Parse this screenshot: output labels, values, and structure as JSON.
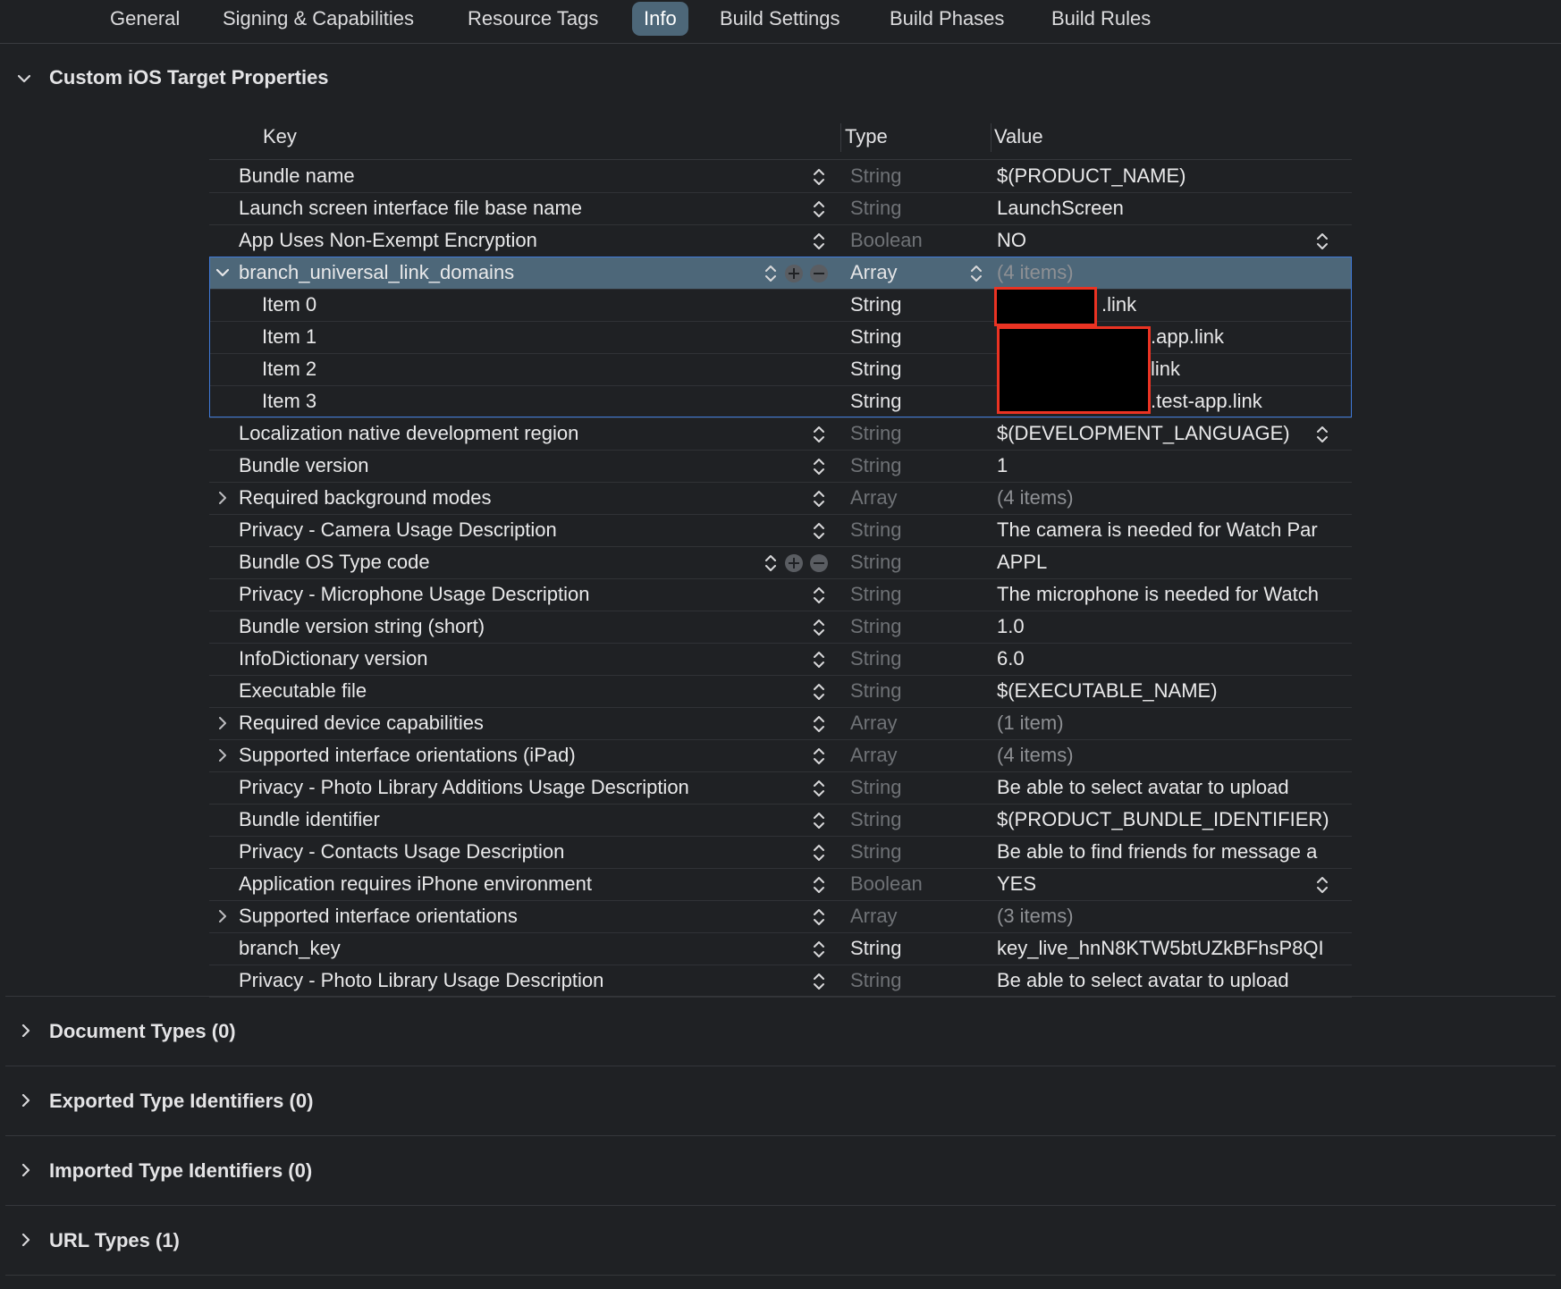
{
  "tabs": [
    {
      "label": "General"
    },
    {
      "label": "Signing & Capabilities"
    },
    {
      "label": "Resource Tags"
    },
    {
      "label": "Info",
      "active": true
    },
    {
      "label": "Build Settings"
    },
    {
      "label": "Build Phases"
    },
    {
      "label": "Build Rules"
    }
  ],
  "custom_section": {
    "title": "Custom iOS Target Properties",
    "expanded": true
  },
  "columns": {
    "key": "Key",
    "type": "Type",
    "value": "Value"
  },
  "rows": [
    {
      "key": "Bundle name",
      "type": "String",
      "value": "$(PRODUCT_NAME)"
    },
    {
      "key": "Launch screen interface file base name",
      "type": "String",
      "value": "LaunchScreen"
    },
    {
      "key": "App Uses Non-Exempt Encryption",
      "type": "Boolean",
      "value": "NO"
    },
    {
      "key": "branch_universal_link_domains",
      "type": "Array",
      "value": "(4 items)"
    },
    {
      "key": "Item 0",
      "type": "String",
      "value": ".link"
    },
    {
      "key": "Item 1",
      "type": "String",
      "value": ".app.link"
    },
    {
      "key": "Item 2",
      "type": "String",
      "value": "link"
    },
    {
      "key": "Item 3",
      "type": "String",
      "value": ".test-app.link"
    },
    {
      "key": "Localization native development region",
      "type": "String",
      "value": "$(DEVELOPMENT_LANGUAGE)"
    },
    {
      "key": "Bundle version",
      "type": "String",
      "value": "1"
    },
    {
      "key": "Required background modes",
      "type": "Array",
      "value": "(4 items)"
    },
    {
      "key": "Privacy - Camera Usage Description",
      "type": "String",
      "value": "The camera is needed for Watch Par"
    },
    {
      "key": "Bundle OS Type code",
      "type": "String",
      "value": "APPL"
    },
    {
      "key": "Privacy - Microphone Usage Description",
      "type": "String",
      "value": "The microphone is needed for Watch"
    },
    {
      "key": "Bundle version string (short)",
      "type": "String",
      "value": "1.0"
    },
    {
      "key": "InfoDictionary version",
      "type": "String",
      "value": "6.0"
    },
    {
      "key": "Executable file",
      "type": "String",
      "value": "$(EXECUTABLE_NAME)"
    },
    {
      "key": "Required device capabilities",
      "type": "Array",
      "value": "(1 item)"
    },
    {
      "key": "Supported interface orientations (iPad)",
      "type": "Array",
      "value": "(4 items)"
    },
    {
      "key": "Privacy - Photo Library Additions Usage Description",
      "type": "String",
      "value": "Be able to select avatar to upload"
    },
    {
      "key": "Bundle identifier",
      "type": "String",
      "value": "$(PRODUCT_BUNDLE_IDENTIFIER)"
    },
    {
      "key": "Privacy - Contacts Usage Description",
      "type": "String",
      "value": "Be able to find friends for message a"
    },
    {
      "key": "Application requires iPhone environment",
      "type": "Boolean",
      "value": "YES"
    },
    {
      "key": "Supported interface orientations",
      "type": "Array",
      "value": "(3 items)"
    },
    {
      "key": "branch_key",
      "type": "String",
      "value": "key_live_hnN8KTW5btUZkBFhsP8QI"
    },
    {
      "key": "Privacy - Photo Library Usage Description",
      "type": "String",
      "value": "Be able to select avatar to upload"
    }
  ],
  "collapsed_sections": [
    {
      "title": "Document Types (0)"
    },
    {
      "title": "Exported Type Identifiers (0)"
    },
    {
      "title": "Imported Type Identifiers (0)"
    },
    {
      "title": "URL Types (1)"
    }
  ],
  "colors": {
    "background": "#1f2124",
    "selection": "#4d6779",
    "focus_ring": "#3f7ad9",
    "redaction_border": "#ea3323"
  }
}
